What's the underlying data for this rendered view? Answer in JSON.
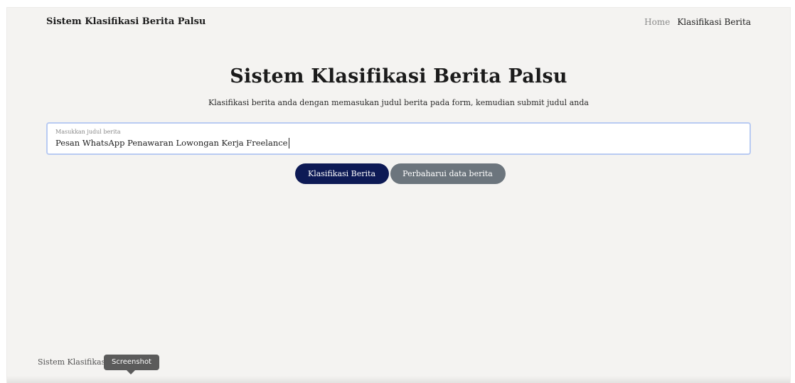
{
  "navbar": {
    "brand": "Sistem Klasifikasi Berita Palsu",
    "links": [
      {
        "label": "Home",
        "active": false
      },
      {
        "label": "Klasifikasi Berita",
        "active": true
      }
    ]
  },
  "hero": {
    "title": "Sistem Klasifikasi Berita Palsu",
    "subtitle": "Klasifikasi berita anda dengan memasukan judul berita pada form, kemudian submit judul anda"
  },
  "form": {
    "input_label": "Masukkan judul berita",
    "input_value": "Pesan WhatsApp Penawaran Lowongan Kerja Freelance"
  },
  "buttons": {
    "classify_label": "Klasifikasi Berita",
    "update_label": "Perbaharui data berita"
  },
  "footer": {
    "text": "Sistem Klasifikasi Berita Palsu"
  },
  "tooltip": {
    "text": "Screenshot"
  },
  "colors": {
    "page_background": "#f4f3f1",
    "primary_button": "#0d1a55",
    "secondary_button": "#6c757d",
    "input_focus_border": "#b9cbf2"
  }
}
